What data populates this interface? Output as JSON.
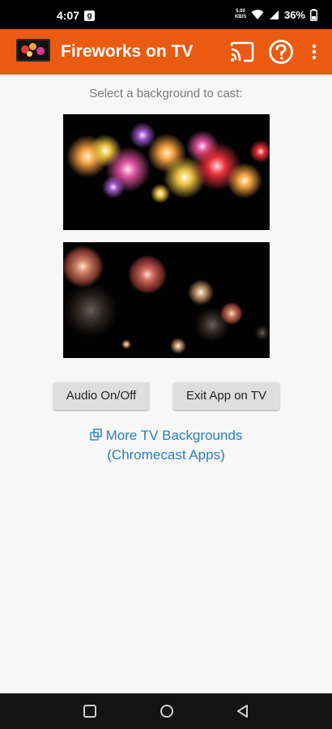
{
  "status_bar": {
    "time": "4:07",
    "notification_glyph": "g",
    "speed": "5.00 KB/S",
    "battery_pct": "36%"
  },
  "app_bar": {
    "title": "Fireworks on TV",
    "icons": [
      "app-logo",
      "cast-icon",
      "help-icon",
      "more-vert-icon"
    ],
    "color": "#ea5a10"
  },
  "main": {
    "prompt": "Select a background to cast:",
    "backgrounds": [
      "fireworks-row-image",
      "fireworks-burst-image"
    ],
    "audio_button": "Audio On/Off",
    "exit_button": "Exit App on TV",
    "more_link_line1": "More TV Backgrounds",
    "more_link_line2": "(Chromecast Apps)",
    "link_color": "#2c7fb8"
  },
  "nav_bar": {
    "icons": [
      "recents-icon",
      "home-icon",
      "back-icon"
    ]
  }
}
